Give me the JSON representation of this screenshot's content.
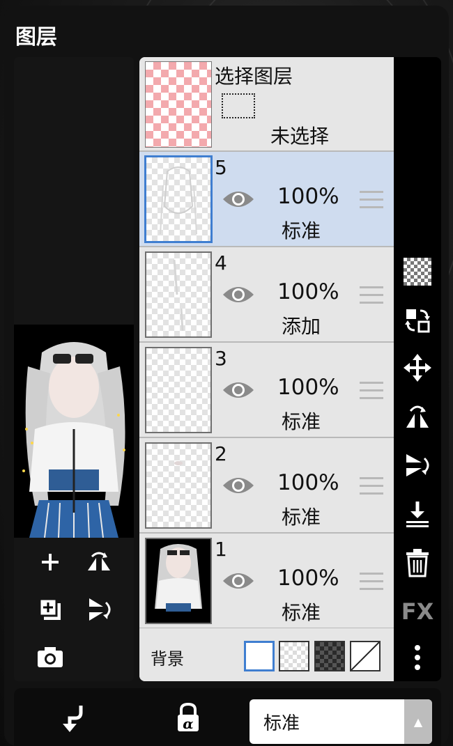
{
  "panel": {
    "title": "图层"
  },
  "selection_layer": {
    "title": "选择图层",
    "status": "未选择"
  },
  "layers": [
    {
      "number": "5",
      "opacity": "100%",
      "blend": "标准",
      "active": true
    },
    {
      "number": "4",
      "opacity": "100%",
      "blend": "添加",
      "active": false
    },
    {
      "number": "3",
      "opacity": "100%",
      "blend": "标准",
      "active": false
    },
    {
      "number": "2",
      "opacity": "100%",
      "blend": "标准",
      "active": false
    },
    {
      "number": "1",
      "opacity": "100%",
      "blend": "标准",
      "active": false
    }
  ],
  "background": {
    "label": "背景",
    "options": [
      "white",
      "transparent",
      "dark-checker",
      "none"
    ],
    "selected": "white"
  },
  "right_toolbar": [
    "transparency-icon",
    "swap-icon",
    "move-icon",
    "flip-horizontal-icon",
    "flip-vertical-icon",
    "merge-down-icon",
    "trash-icon",
    "fx-icon",
    "more-icon"
  ],
  "fx_label": "FX",
  "left_tools": [
    "add-layer-icon",
    "flip-horizontal-icon",
    "add-canvas-icon",
    "flip-vertical-icon",
    "camera-icon"
  ],
  "bottom_bar": {
    "blend_mode": "标准",
    "lock_icon": "alpha-lock-icon",
    "clip_icon": "clip-icon"
  },
  "colors": {
    "accent": "#3f7ed0",
    "active_row": "#cfdcef",
    "selection_checker": "#f3a9ad"
  }
}
